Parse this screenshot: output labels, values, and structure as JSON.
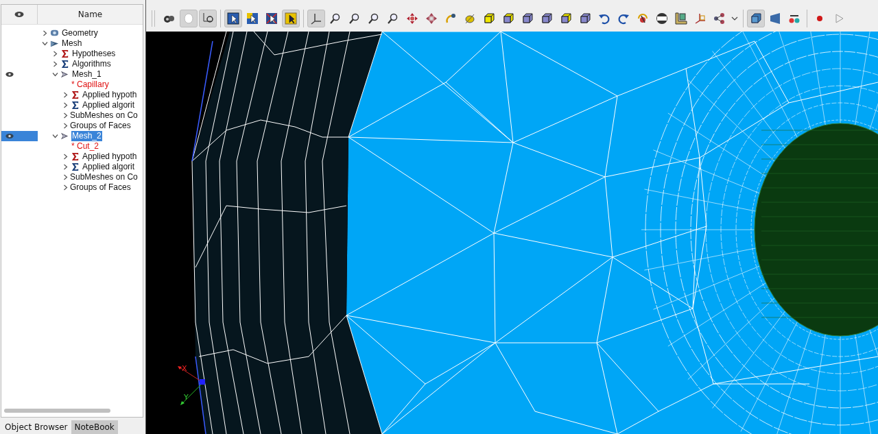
{
  "object_browser": {
    "columns": [
      "Name"
    ],
    "tree": [
      {
        "name": "Geometry",
        "kind": "geometry",
        "expanded": false,
        "visible": false,
        "selected": false
      },
      {
        "name": "Mesh",
        "kind": "component",
        "expanded": true,
        "visible": false,
        "selected": false,
        "children": [
          {
            "name": "Hypotheses",
            "kind": "hypotheses",
            "expanded": false,
            "visible": false,
            "selected": false
          },
          {
            "name": "Algorithms",
            "kind": "algorithms",
            "expanded": false,
            "visible": false,
            "selected": false
          },
          {
            "name": "Mesh_1",
            "kind": "mesh",
            "expanded": true,
            "visible": true,
            "selected": false,
            "children": [
              {
                "name": "* Capillary",
                "kind": "reference",
                "visible": false,
                "selected": false
              },
              {
                "name": "Applied hypoth",
                "kind": "hypotheses",
                "expanded": false,
                "visible": false,
                "selected": false
              },
              {
                "name": "Applied algorit",
                "kind": "algorithms",
                "expanded": false,
                "visible": false,
                "selected": false
              },
              {
                "name": "SubMeshes on Co",
                "kind": "folder",
                "expanded": false,
                "visible": false,
                "selected": false
              },
              {
                "name": "Groups of Faces",
                "kind": "folder",
                "expanded": false,
                "visible": false,
                "selected": false
              }
            ]
          },
          {
            "name": "Mesh_2",
            "kind": "mesh",
            "expanded": true,
            "visible": true,
            "selected": true,
            "children": [
              {
                "name": "* Cut_2",
                "kind": "reference",
                "visible": false,
                "selected": false
              },
              {
                "name": "Applied hypoth",
                "kind": "hypotheses",
                "expanded": false,
                "visible": false,
                "selected": false
              },
              {
                "name": "Applied algorit",
                "kind": "algorithms",
                "expanded": false,
                "visible": false,
                "selected": false
              },
              {
                "name": "SubMeshes on Co",
                "kind": "folder",
                "expanded": false,
                "visible": false,
                "selected": false
              },
              {
                "name": "Groups of Faces",
                "kind": "folder",
                "expanded": false,
                "visible": false,
                "selected": false
              }
            ]
          }
        ]
      }
    ],
    "tabs": [
      {
        "label": "Object Browser",
        "selected": true
      },
      {
        "label": "NoteBook",
        "selected": false
      }
    ]
  },
  "toolbar": {
    "groups": [
      [
        {
          "checked": false
        },
        {
          "checked": true
        },
        {
          "checked": true
        }
      ],
      [
        {
          "checked": true
        },
        {
          "checked": false
        },
        {
          "checked": false
        },
        {
          "checked": true
        }
      ],
      [
        {
          "checked": true
        },
        {
          "checked": false
        },
        {
          "checked": false
        },
        {
          "checked": false
        },
        {
          "checked": false
        },
        {
          "checked": false
        },
        {
          "checked": false
        },
        {
          "checked": false
        },
        {
          "checked": false
        },
        {
          "checked": false
        },
        {
          "checked": false
        },
        {
          "checked": false
        },
        {
          "checked": false
        },
        {
          "checked": false
        },
        {
          "checked": false
        },
        {
          "checked": false
        },
        {
          "checked": false
        },
        {
          "checked": false
        },
        {
          "checked": false
        },
        {
          "checked": false
        },
        {
          "checked": false
        },
        {
          "checked": false
        }
      ],
      [
        {
          "checked": true
        },
        {
          "checked": false
        },
        {
          "checked": false
        }
      ],
      [
        {
          "checked": false
        },
        {
          "checked": false
        }
      ]
    ]
  },
  "viewer": {
    "axis_labels": [
      "X",
      "Y"
    ]
  }
}
